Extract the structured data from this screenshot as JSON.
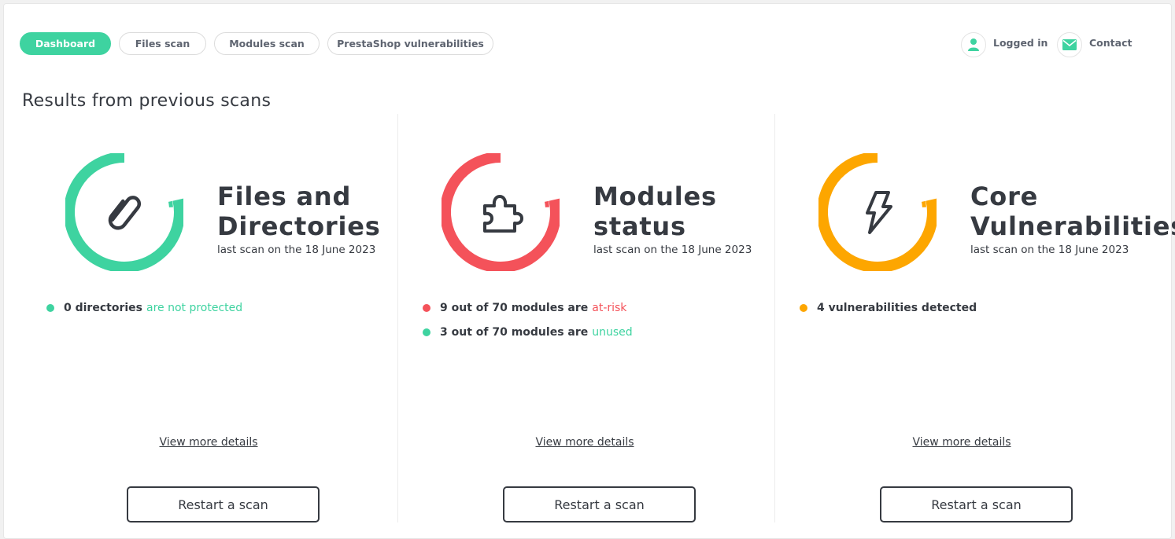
{
  "colors": {
    "green": "#3ed3a0",
    "red": "#f4525a",
    "orange": "#fda600",
    "text": "#363a41"
  },
  "nav": {
    "tabs": [
      {
        "label": "Dashboard",
        "active": true
      },
      {
        "label": "Files scan",
        "active": false
      },
      {
        "label": "Modules scan",
        "active": false
      },
      {
        "label": "PrestaShop vulnerabilities",
        "active": false
      }
    ],
    "logged_in": {
      "label": "Logged in",
      "icon": "user-icon"
    },
    "contact": {
      "label": "Contact",
      "icon": "envelope-icon"
    }
  },
  "page_title": "Results from previous scans",
  "cards": [
    {
      "title_line1": "Files and",
      "title_line2": "Directories",
      "last_scan": "last scan on the 18 June 2023",
      "icon": "paperclip-icon",
      "color": "#3ed3a0",
      "stats": [
        {
          "count_text": "0 directories",
          "highlight": "are not protected",
          "status_color": "#3ed3a0"
        }
      ],
      "details_link": "View more details",
      "restart_label": "Restart a scan"
    },
    {
      "title_line1": "Modules",
      "title_line2": "status",
      "last_scan": "last scan on the 18 June 2023",
      "icon": "puzzle-piece-icon",
      "color": "#f4525a",
      "stats": [
        {
          "count_text": "9 out of 70 modules are",
          "highlight": "at-risk",
          "status_color": "#f4525a"
        },
        {
          "count_text": "3 out of 70 modules are",
          "highlight": "unused",
          "status_color": "#3ed3a0"
        }
      ],
      "details_link": "View more details",
      "restart_label": "Restart a scan"
    },
    {
      "title_line1": "Core",
      "title_line2": "Vulnerabilities",
      "last_scan": "last scan on the 18 June 2023",
      "icon": "lightning-bolt-icon",
      "color": "#fda600",
      "stats": [
        {
          "count_text": "4 vulnerabilities detected",
          "highlight": "",
          "status_color": "#fda600"
        }
      ],
      "details_link": "View more details",
      "restart_label": "Restart a scan"
    }
  ]
}
